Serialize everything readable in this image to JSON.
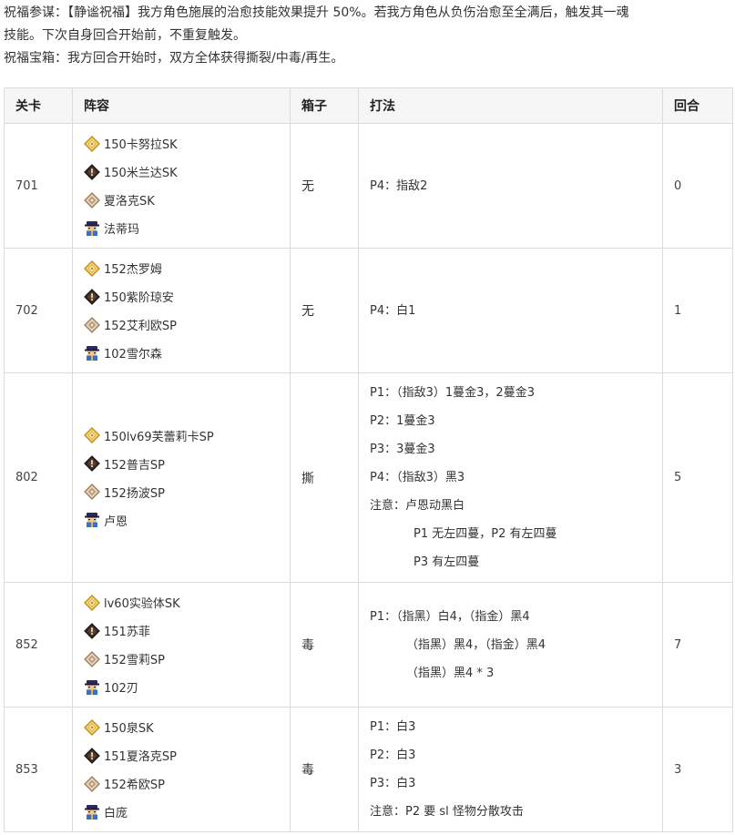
{
  "intro": {
    "line1": "祝福参谋：【静谧祝福】我方角色施展的治愈技能效果提升 50%。若我方角色从负伤治愈至全满后，触发其一魂",
    "line2": "技能。下次自身回合开始前，不重复触发。",
    "line3": "祝福宝箱：我方回合开始时，双方全体获得撕裂/中毒/再生。"
  },
  "headers": {
    "level": "关卡",
    "lineup": "阵容",
    "box": "箱子",
    "method": "打法",
    "rounds": "回合"
  },
  "icons": {
    "gold": "gold-diamond-icon",
    "dark": "dark-diamond-icon",
    "tan": "tan-diamond-icon",
    "person": "npc-person-icon"
  },
  "rows": [
    {
      "level": "701",
      "units": [
        "150卡努拉SK",
        "150米兰达SK",
        "夏洛克SK",
        "法蒂玛"
      ],
      "box": "无",
      "plan": [
        "P4：指敌2"
      ],
      "rounds": "0"
    },
    {
      "level": "702",
      "units": [
        "152杰罗姆",
        "150紫阶琼安",
        "152艾利欧SP",
        "102雪尔森"
      ],
      "box": "无",
      "plan": [
        "P4：白1"
      ],
      "rounds": "1"
    },
    {
      "level": "802",
      "units": [
        "150lv69芙蕾莉卡SP",
        "152普吉SP",
        "152扬波SP",
        "卢恩"
      ],
      "box": "撕",
      "plan": [
        "P1：（指敌3）1蔓金3，2蔓金3",
        "P2：1蔓金3",
        "P3：3蔓金3",
        "P4：（指敌3）黑3",
        "注意：卢恩动黑白",
        "P1 无左四蔓，P2 有左四蔓",
        "P3 有左四蔓"
      ],
      "rounds": "5"
    },
    {
      "level": "852",
      "units": [
        "lv60实验体SK",
        "151苏菲",
        "152雪莉SP",
        "102刃"
      ],
      "box": "毒",
      "plan": [
        "P1：（指黑）白4，（指金）黑4",
        "（指黑）黑4，（指金）黑4",
        "（指黑）黑4 * 3"
      ],
      "rounds": "7"
    },
    {
      "level": "853",
      "units": [
        "150泉SK",
        "151夏洛克SP",
        "152希欧SP",
        "白庞"
      ],
      "box": "毒",
      "plan": [
        "P1：白3",
        "P2：白3",
        "P3：白3",
        "注意：P2 要 sl 怪物分散攻击"
      ],
      "rounds": "3"
    }
  ]
}
